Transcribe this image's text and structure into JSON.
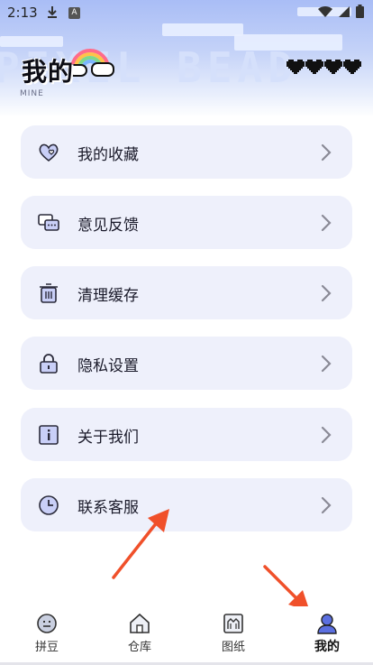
{
  "status_bar": {
    "time": "2:13",
    "badge": "A"
  },
  "header": {
    "title": "我的",
    "subtitle": "MINE",
    "background_text": "PIXEL BEAD"
  },
  "menu": {
    "items": [
      {
        "label": "我的收藏",
        "icon": "heart-chat-icon"
      },
      {
        "label": "意见反馈",
        "icon": "feedback-chat-icon"
      },
      {
        "label": "清理缓存",
        "icon": "trash-icon"
      },
      {
        "label": "隐私设置",
        "icon": "lock-icon"
      },
      {
        "label": "关于我们",
        "icon": "info-icon"
      },
      {
        "label": "联系客服",
        "icon": "clock-icon"
      }
    ]
  },
  "tabbar": {
    "tabs": [
      {
        "label": "拼豆",
        "icon": "bean-face-icon",
        "active": false
      },
      {
        "label": "仓库",
        "icon": "warehouse-icon",
        "active": false
      },
      {
        "label": "图纸",
        "icon": "pattern-icon",
        "active": false
      },
      {
        "label": "我的",
        "icon": "user-icon",
        "active": true
      }
    ]
  },
  "colors": {
    "accent": "#5b6fe0",
    "card_bg": "#eef0fb",
    "arrow": "#f0502a",
    "header_top": "#a9bdf6"
  }
}
